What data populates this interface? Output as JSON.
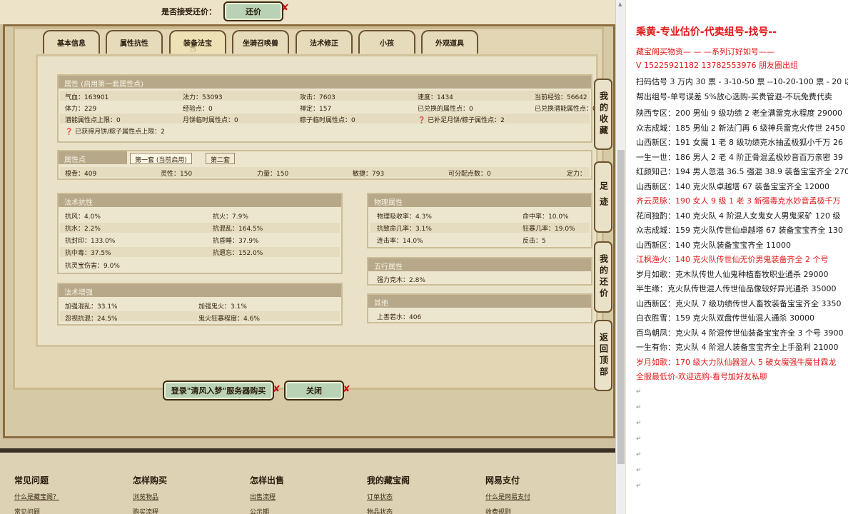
{
  "bargain": {
    "label": "是否接受还价：",
    "button": "还价"
  },
  "tabs": [
    "基本信息",
    "属性抗性",
    "装备法宝",
    "坐骑召唤兽",
    "法术修正",
    "小孩",
    "外观道具"
  ],
  "attributes": {
    "title": "属性 (启用第一套属性点)",
    "rows": [
      [
        "气血：163901",
        "法力：53093",
        "攻击：7603",
        "速度：1434",
        "当前经验：56642"
      ],
      [
        "体力：229",
        "经验点：0",
        "禅定：157",
        "已兑换的属性点：0",
        "已兑换潜能属性点：0"
      ],
      [
        "潜能属性点上限：0",
        "月饼临时属性点：0",
        "粽子临时属性点：0",
        "已补足月饼/粽子属性点：2",
        ""
      ]
    ],
    "note": "已获得月饼/粽子属性点上限：2"
  },
  "points": {
    "title": "属性点",
    "tab1": "第一套 (当前启用)",
    "tab2": "第二套",
    "values": [
      "根骨：409",
      "灵性：150",
      "力量：150",
      "敏捷：793",
      "可分配点数：0",
      "定力："
    ]
  },
  "resist": {
    "title": "法术抗性",
    "rows": [
      [
        "抗风：4.0%",
        "抗火：7.9%"
      ],
      [
        "抗水：2.2%",
        "抗混乱：164.5%"
      ],
      [
        "抗封印：133.0%",
        "抗昏睡：37.9%"
      ],
      [
        "抗中毒：37.5%",
        "抗遗忘：152.0%"
      ],
      [
        "抗灵宝伤害：9.0%",
        ""
      ]
    ]
  },
  "enhance": {
    "title": "法术增强",
    "rows": [
      [
        "加强混乱：33.1%",
        "加强鬼火：3.1%"
      ],
      [
        "忽视抗混：24.5%",
        "鬼火狂暴程度：4.6%"
      ]
    ]
  },
  "physical": {
    "title": "物理属性",
    "rows": [
      [
        "物理吸收率：4.3%",
        "命中率：10.0%"
      ],
      [
        "抗致命几率：3.1%",
        "狂暴几率：19.0%"
      ],
      [
        "连击率：14.0%",
        "反击：5"
      ]
    ]
  },
  "elements": {
    "title": "五行属性",
    "value": "强力克木：2.8%"
  },
  "other": {
    "title": "其他",
    "value": "上善若水：406"
  },
  "actions": {
    "buy": "登录\"清风入梦\"服务器购买",
    "close": "关闭"
  },
  "side_tabs": [
    "我的收藏",
    "足迹",
    "我的还价",
    "返回顶部"
  ],
  "footer": [
    {
      "head": "常见问题",
      "links": [
        "什么是藏宝阁？",
        "常见问题"
      ]
    },
    {
      "head": "怎样购买",
      "links": [
        "浏览物品",
        "购买流程"
      ]
    },
    {
      "head": "怎样出售",
      "links": [
        "出售流程",
        "公示期"
      ]
    },
    {
      "head": "我的藏宝阁",
      "links": [
        "订单状态",
        "物品状态"
      ]
    },
    {
      "head": "网易支付",
      "links": [
        "什么是网易支付",
        "收费规则"
      ]
    }
  ],
  "doc": {
    "title": "乘黄-专业估价-代卖组号-找号--",
    "line1": "藏宝阁买物资—  —  —系列订好如号——",
    "line2": "V 15225921182   13782553976 朋友圈出组",
    "line3": "扫码估号 3 万内 30 票 - 3-10-50 票  --10-20-100 票 - 20 以上",
    "line4": "帮出组号-单号误差 5%放心选购-买贵管退-不玩免费代卖",
    "listings": [
      {
        "text": "陕西专区：200 男仙 9 级功绩 2 老全满雷克水程度 29000",
        "red": false
      },
      {
        "text": "众志成城：185 男仙 2 新法门再 6 级神兵雷克火传世 2450",
        "red": false
      },
      {
        "text": "山西新区：191 女魔 1 老 8 级功绩克水抽孟极狐小千万 26",
        "red": false
      },
      {
        "text": "一生一世：186 男人 2 老 4 阶正骨混孟极妙音百万亲密 39",
        "red": false
      },
      {
        "text": "红颜知己：194 男人忽混 36.5 强混 38.9 装备宝宝齐全 270",
        "red": false
      },
      {
        "text": "山西新区：140 克火队卓越塔 67 装备宝宝齐全 12000",
        "red": false
      },
      {
        "text": "齐云灵脉：190 女人 9 级 1 老 3 新强毒克水妙音孟极千万",
        "red": true
      },
      {
        "text": "花间独酌：140 克火队 4 阶混人女鬼女人男鬼采矿 120 级",
        "red": false
      },
      {
        "text": "众志成城：159 克火队传世仙卓越塔 67 装备宝宝齐全 130",
        "red": false
      },
      {
        "text": "山西新区：140 克火队装备宝宝齐全 11000",
        "red": false
      },
      {
        "text": "江枫渔火：140 克火队传世仙无价男鬼装备齐全 2 个号",
        "red": true
      },
      {
        "text": "岁月如歌：克木队传世人仙鬼种植畜牧职业通杀 29000",
        "red": false
      },
      {
        "text": "半生缘：克火队传世混人传世仙品像较好异光通杀 35000",
        "red": false
      },
      {
        "text": "山西新区：克火队 7 级功绩传世人畜牧装备宝宝齐全 3350",
        "red": false
      },
      {
        "text": "白衣胜雪：159 克火队双盘传世仙混人通杀 30000",
        "red": false
      },
      {
        "text": "百鸟朝凤：克火队 4 阶混传世仙装备宝宝齐全 3 个号 3900",
        "red": false
      },
      {
        "text": "一生有你：克火队 4 阶混人装备宝宝齐全上手盈利 21000",
        "red": false
      },
      {
        "text": "岁月如歌：170 级大力队仙器混人 5 破女魔强牛魔甘霖龙",
        "red": true
      },
      {
        "text": "全服最低价-欢迎选购-看号加好友私聊",
        "red": true
      }
    ]
  },
  "colors": {
    "accent_red": "#e01818",
    "button_green": "#b9d2b6",
    "frame_brown": "#6b5230"
  }
}
